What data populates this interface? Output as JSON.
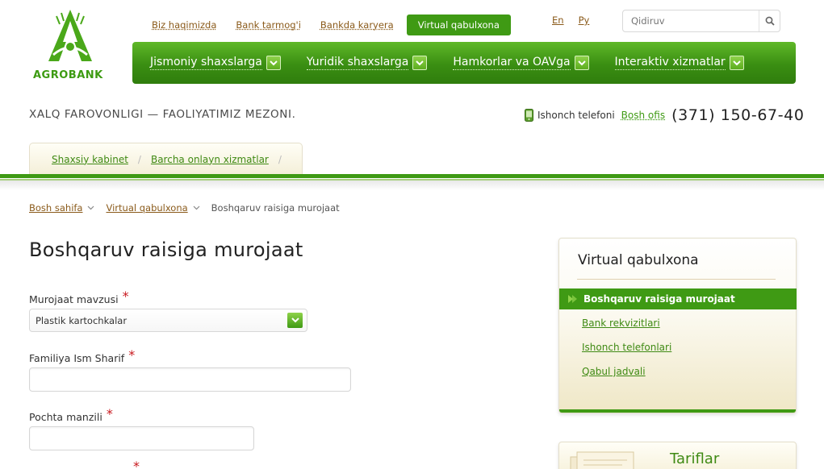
{
  "logo": {
    "text": "AGROBANK"
  },
  "topnav": {
    "links": [
      "Biz haqimizda",
      "Bank tarmog'i",
      "Bankda karyera"
    ],
    "active": "Virtual qabulxona"
  },
  "langs": [
    "En",
    "Ру"
  ],
  "search": {
    "placeholder": "Qidiruv"
  },
  "mainnav": [
    "Jismoniy shaxslarga",
    "Yuridik shaxslarga",
    "Hamkorlar va OAVga",
    "Interaktiv xizmatlar"
  ],
  "slogan": "XALQ FAROVONLIGI — FAOLIYATIMIZ MEZONI.",
  "trust": {
    "label": "Ishonch telefoni",
    "office": "Bosh ofis",
    "number": "(371) 150-67-40"
  },
  "cabinet": {
    "link1": "Shaxsiy kabinet",
    "sep": "/",
    "link2": "Barcha onlayn xizmatlar"
  },
  "breadcrumb": {
    "home": "Bosh sahifa",
    "section": "Virtual qabulxona",
    "current": "Boshqaruv raisiga murojaat"
  },
  "form": {
    "title": "Boshqaruv raisiga murojaat",
    "topic_label": "Murojaat mavzusi",
    "topic_value": "Plastik kartochkalar",
    "name_label": "Familiya Ism Sharif",
    "email_label": "Pochta manzili",
    "required_mark": "*"
  },
  "sidebar": {
    "title": "Virtual qabulxona",
    "active": "Boshqaruv raisiga murojaat",
    "links": [
      "Bank rekvizitlari",
      "Ishonch telefonlari",
      "Qabul jadvali"
    ]
  },
  "tariff": {
    "title": "Tariflar"
  },
  "colors": {
    "brand_green": "#3f9a14",
    "link_brown": "#8a5a1a",
    "required_red": "#c8181e"
  }
}
